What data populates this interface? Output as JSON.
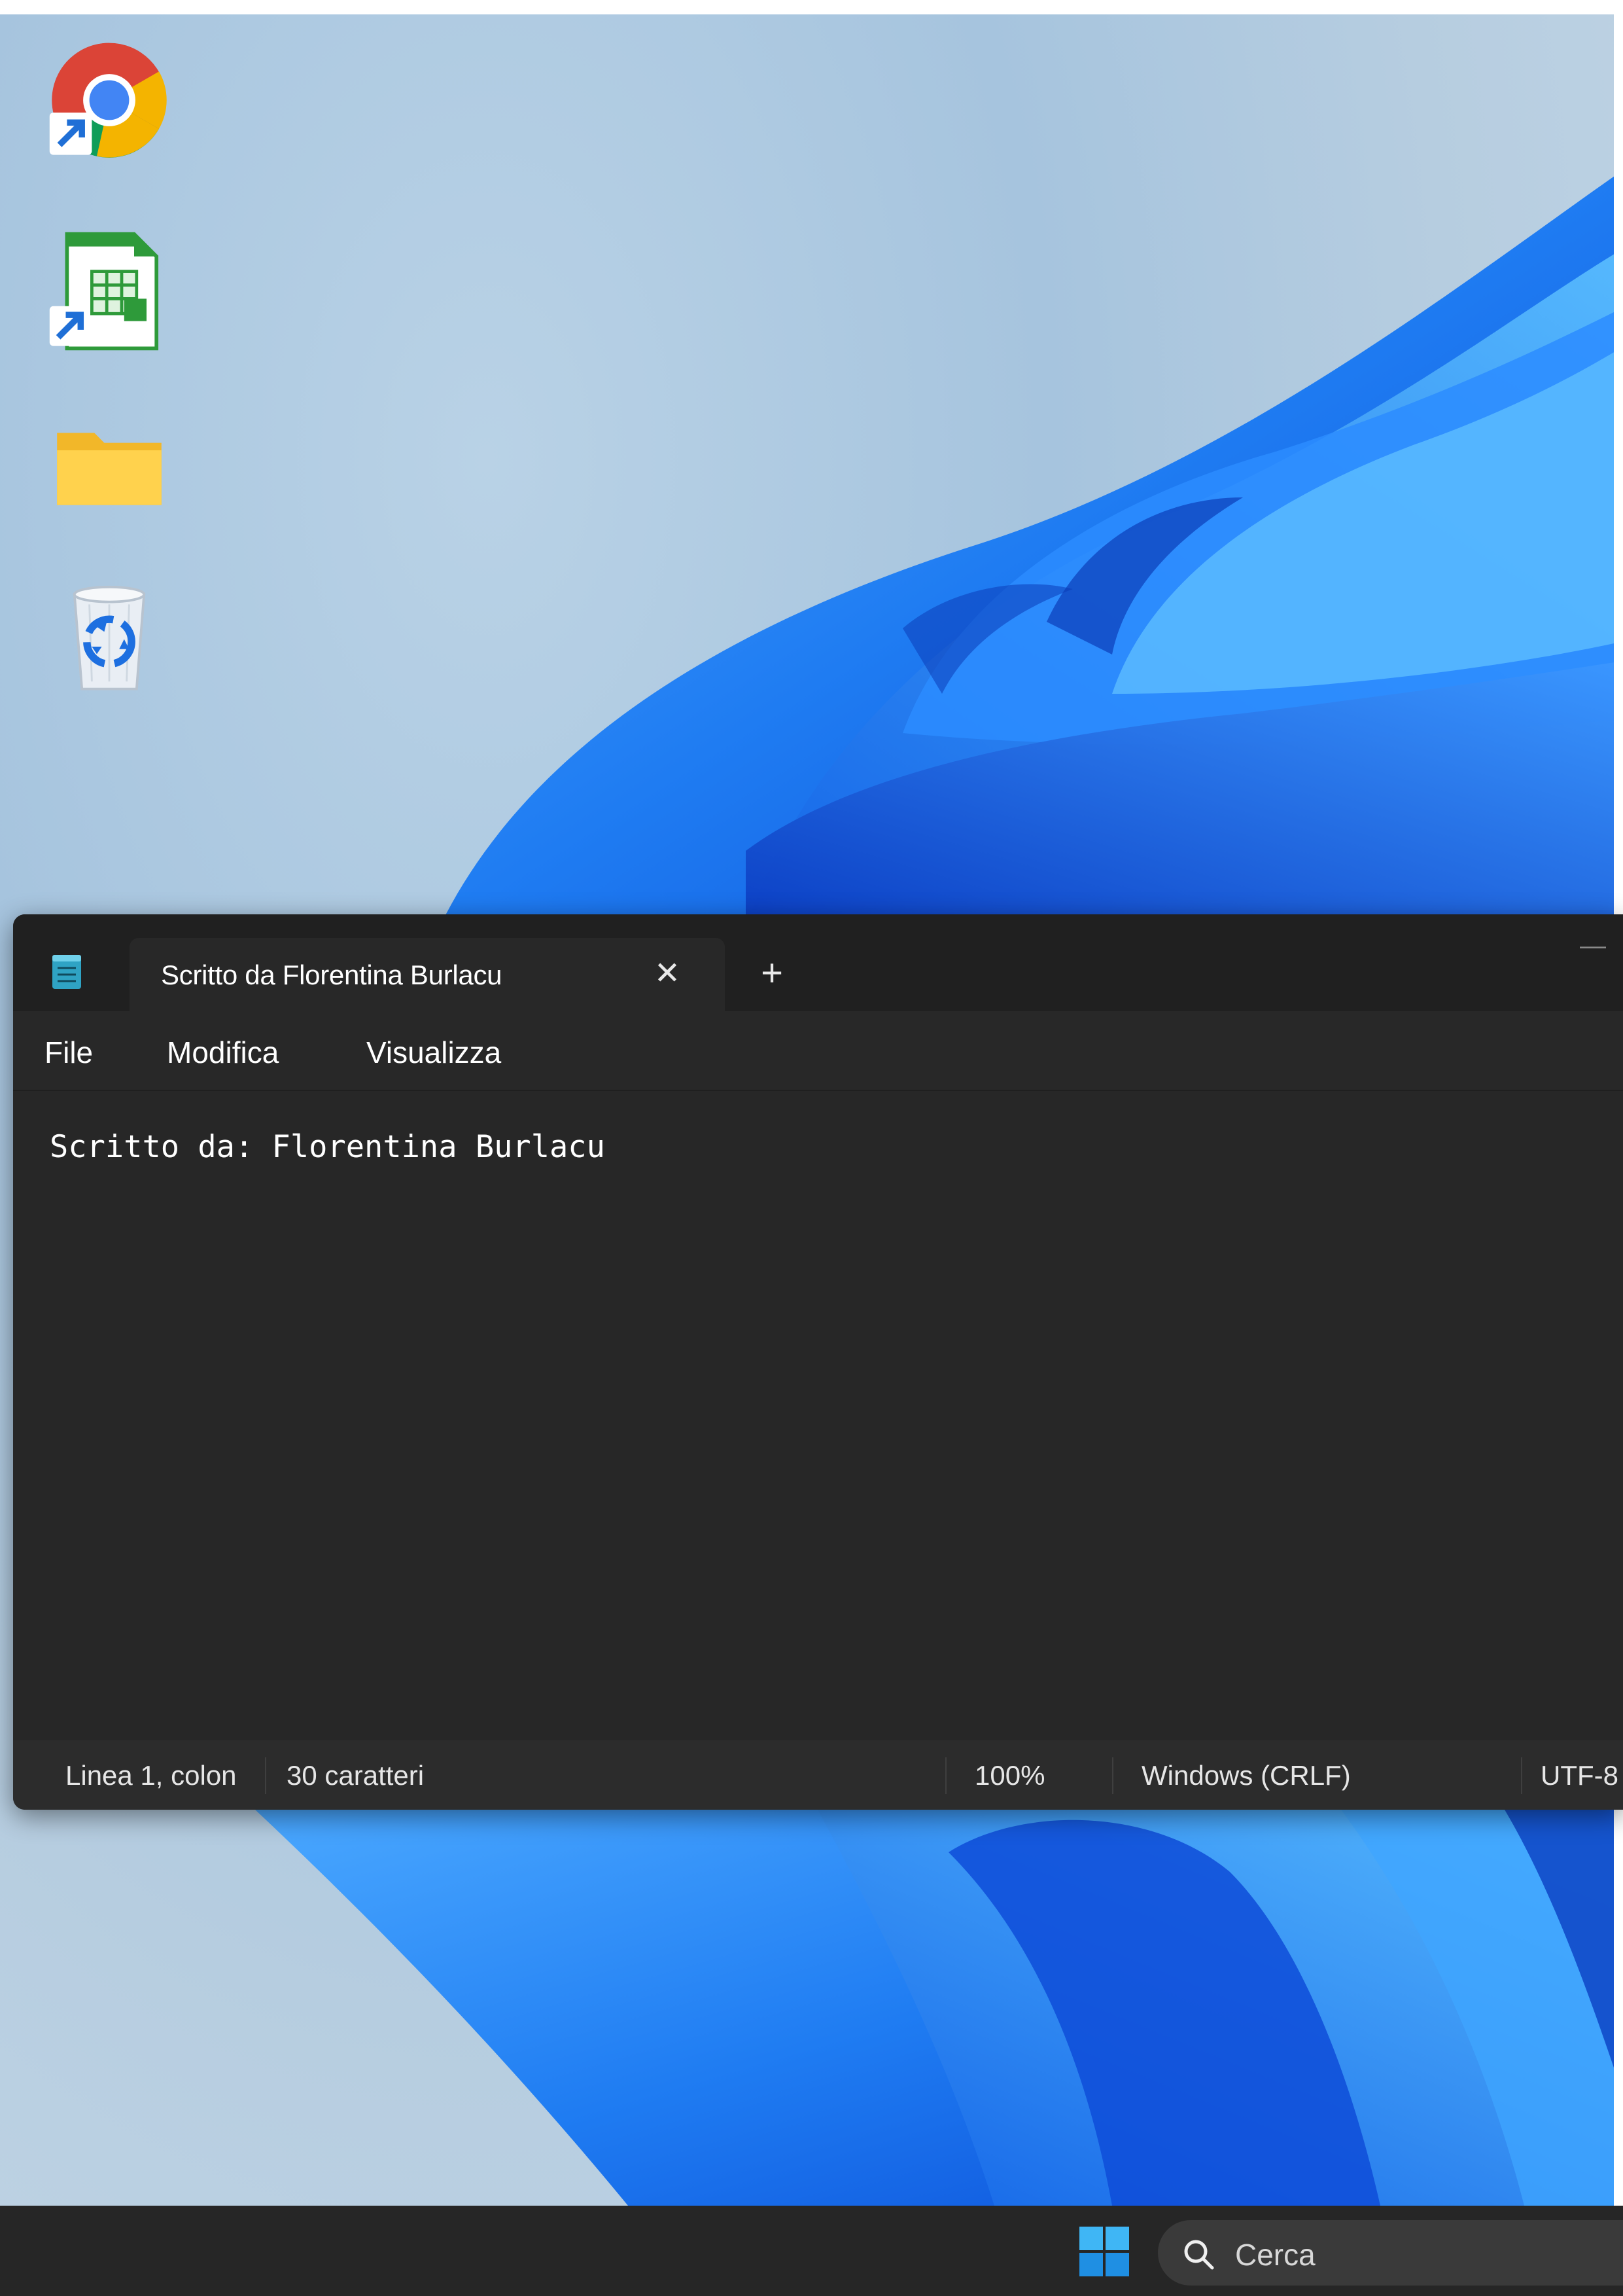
{
  "desktop": {
    "icons": [
      {
        "name": "Google Chrome"
      },
      {
        "name": "LibreOffice Calc"
      },
      {
        "name": "Folder"
      },
      {
        "name": "Recycle Bin"
      }
    ]
  },
  "notepad": {
    "tab_title": "Scritto da Florentina Burlacu",
    "tab_close_glyph": "✕",
    "new_tab_glyph": "+",
    "minimize_glyph": "—",
    "menu": {
      "file": "File",
      "edit": "Modifica",
      "view": "Visualizza"
    },
    "content": "Scritto da: Florentina Burlacu",
    "status": {
      "position": "Linea 1, colon",
      "chars": "30 caratteri",
      "zoom": "100%",
      "line_ending": "Windows (CRLF)",
      "encoding": "UTF-8"
    }
  },
  "taskbar": {
    "search_placeholder": "Cerca"
  },
  "colors": {
    "window_bg": "#272727",
    "titlebar_bg": "#202020",
    "taskbar_bg": "#262626",
    "wallpaper_blue": "#1a73f0"
  }
}
